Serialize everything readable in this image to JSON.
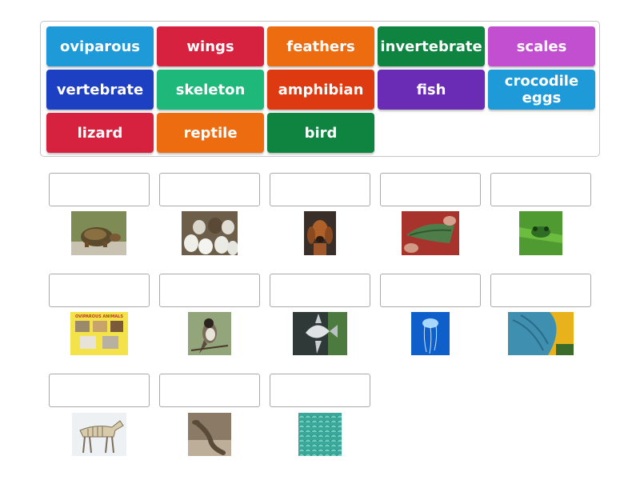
{
  "tiles": [
    {
      "label": "oviparous",
      "color": "#1e9ad8"
    },
    {
      "label": "wings",
      "color": "#d6213f"
    },
    {
      "label": "feathers",
      "color": "#ee6c10"
    },
    {
      "label": "invertebrate",
      "color": "#0f8340"
    },
    {
      "label": "scales",
      "color": "#c24ed0"
    },
    {
      "label": "vertebrate",
      "color": "#1d3fc1"
    },
    {
      "label": "skeleton",
      "color": "#1eb87a"
    },
    {
      "label": "amphibian",
      "color": "#de3a12"
    },
    {
      "label": "fish",
      "color": "#6a2bb5"
    },
    {
      "label": "crocodile eggs",
      "color": "#1e9ad8"
    },
    {
      "label": "lizard",
      "color": "#d6213f"
    },
    {
      "label": "reptile",
      "color": "#ee6c10"
    },
    {
      "label": "bird",
      "color": "#0f8340"
    }
  ],
  "slots": [
    {
      "image": "turtle-photo"
    },
    {
      "image": "hatching-eggs-photo"
    },
    {
      "image": "dachshund-dog-photo"
    },
    {
      "image": "bird-wing-photo"
    },
    {
      "image": "tree-frog-photo"
    },
    {
      "image": "oviparous-animals-poster",
      "poster_text": "OVIPAROUS ANIMALS"
    },
    {
      "image": "perched-bird-photo"
    },
    {
      "image": "angelfish-photo"
    },
    {
      "image": "jellyfish-photo"
    },
    {
      "image": "parrot-feathers-photo"
    },
    {
      "image": "horse-skeleton-drawing"
    },
    {
      "image": "lizard-on-rock-photo"
    },
    {
      "image": "fish-scales-photo"
    }
  ]
}
